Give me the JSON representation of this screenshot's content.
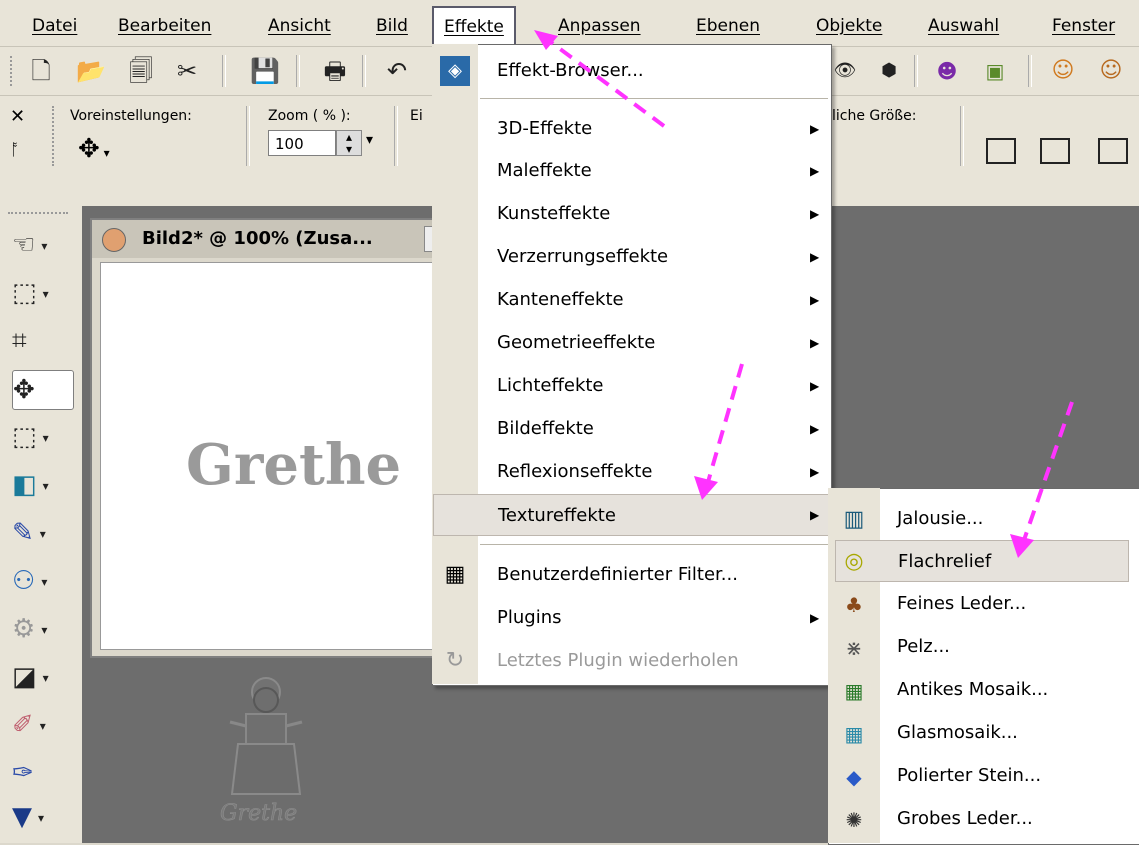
{
  "menubar": {
    "items": [
      "Datei",
      "Bearbeiten",
      "Ansicht",
      "Bild",
      "Effekte",
      "Anpassen",
      "Ebenen",
      "Objekte",
      "Auswahl",
      "Fenster"
    ]
  },
  "toolbar2": {
    "voreinstellungen_label": "Voreinstellungen:",
    "zoom_label": "Zoom ( % ):",
    "zoom_value": "100",
    "truncated_label": "Ei",
    "size_label": "liche Größe:"
  },
  "document": {
    "title": "Bild2* @ 100% (Zusa...",
    "canvas_text": "Grethe",
    "embossed_text": "Grethe"
  },
  "effects_menu": {
    "items": [
      {
        "label": "Effekt-Browser...",
        "submenu": false,
        "icon": "effect-browser-icon"
      },
      {
        "label": "3D-Effekte",
        "submenu": true
      },
      {
        "label": "Maleffekte",
        "submenu": true
      },
      {
        "label": "Kunsteffekte",
        "submenu": true
      },
      {
        "label": "Verzerrungseffekte",
        "submenu": true
      },
      {
        "label": "Kanteneffekte",
        "submenu": true
      },
      {
        "label": "Geometrieeffekte",
        "submenu": true
      },
      {
        "label": "Lichteffekte",
        "submenu": true
      },
      {
        "label": "Bildeffekte",
        "submenu": true
      },
      {
        "label": "Reflexionseffekte",
        "submenu": true
      },
      {
        "label": "Textureffekte",
        "submenu": true,
        "highlighted": true
      },
      {
        "label": "Benutzerdefinierter Filter...",
        "submenu": false,
        "icon": "grid-filter-icon"
      },
      {
        "label": "Plugins",
        "submenu": true
      },
      {
        "label": "Letztes Plugin wiederholen",
        "submenu": false,
        "disabled": true,
        "icon": "repeat-plugin-icon"
      }
    ]
  },
  "texture_submenu": {
    "items": [
      {
        "label": "Jalousie...",
        "icon": "blinds-icon"
      },
      {
        "label": "Flachrelief",
        "icon": "relief-icon",
        "highlighted": true
      },
      {
        "label": "Feines Leder...",
        "icon": "leather-icon"
      },
      {
        "label": "Pelz...",
        "icon": "fur-icon"
      },
      {
        "label": "Antikes Mosaik...",
        "icon": "antique-mosaic-icon"
      },
      {
        "label": "Glasmosaik...",
        "icon": "glass-mosaic-icon"
      },
      {
        "label": "Polierter Stein...",
        "icon": "polished-stone-icon"
      },
      {
        "label": "Grobes Leder...",
        "icon": "coarse-leather-icon"
      }
    ]
  },
  "colors": {
    "arrow": "#ff33ff",
    "highlight": "#e6e2dc",
    "workspace": "#6d6d6d",
    "chrome": "#e8e4d8"
  }
}
